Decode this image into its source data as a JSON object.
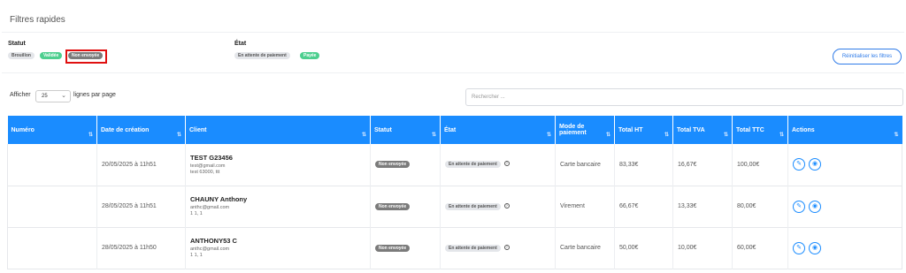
{
  "filters": {
    "title": "Filtres rapides",
    "statut": {
      "label": "Statut",
      "options": [
        {
          "label": "Brouillon",
          "color": "#e4e6ea"
        },
        {
          "label": "Validée",
          "color": "#4dcf8f"
        },
        {
          "label": "Non envoyée",
          "color": "#7b7b7b",
          "selected": true
        }
      ]
    },
    "etat": {
      "label": "État",
      "options": [
        {
          "label": "En attente de paiement",
          "color": "#e4e6ea"
        },
        {
          "label": "Payée",
          "color": "#4dcf8f"
        }
      ]
    },
    "reset_label": "Réinitialiser les filtres"
  },
  "controls": {
    "show_label": "Afficher",
    "page_size": "25",
    "per_page_label": "lignes par page",
    "search_placeholder": "Rechercher ..."
  },
  "table": {
    "columns": [
      {
        "label": "Numéro"
      },
      {
        "label": "Date de création"
      },
      {
        "label": "Client"
      },
      {
        "label": "Statut"
      },
      {
        "label": "État"
      },
      {
        "label": "Mode de paiement"
      },
      {
        "label": "Total HT"
      },
      {
        "label": "Total TVA"
      },
      {
        "label": "Total TTC"
      },
      {
        "label": "Actions"
      }
    ],
    "rows": [
      {
        "numero": "",
        "date": "20/05/2025 à 11h51",
        "client_name": "TEST G23456",
        "client_email": "test@gmail.com",
        "client_address": "test 63000, ttt",
        "statut": "Non envoyée",
        "etat": "En attente de paiement",
        "mode": "Carte bancaire",
        "ht": "83,33€",
        "tva": "16,67€",
        "ttc": "100,00€"
      },
      {
        "numero": "",
        "date": "28/05/2025 à 11h51",
        "client_name": "CHAUNY Anthony",
        "client_email": "anthc@gmail.com",
        "client_address": "1 1, 1",
        "statut": "Non envoyée",
        "etat": "En attente de paiement",
        "mode": "Virement",
        "ht": "66,67€",
        "tva": "13,33€",
        "ttc": "80,00€"
      },
      {
        "numero": "",
        "date": "28/05/2025 à 11h50",
        "client_name": "ANTHONY53 C",
        "client_email": "anthc@gmail.com",
        "client_address": "1 1, 1",
        "statut": "Non envoyée",
        "etat": "En attente de paiement",
        "mode": "Carte bancaire",
        "ht": "50,00€",
        "tva": "10,00€",
        "ttc": "60,00€"
      }
    ]
  },
  "colors": {
    "accent": "#1a8cff",
    "highlight": "#e01010"
  },
  "icons": {
    "sort": "sort-icon",
    "info": "info-icon",
    "edit": "pencil-icon",
    "view": "eye-icon"
  }
}
